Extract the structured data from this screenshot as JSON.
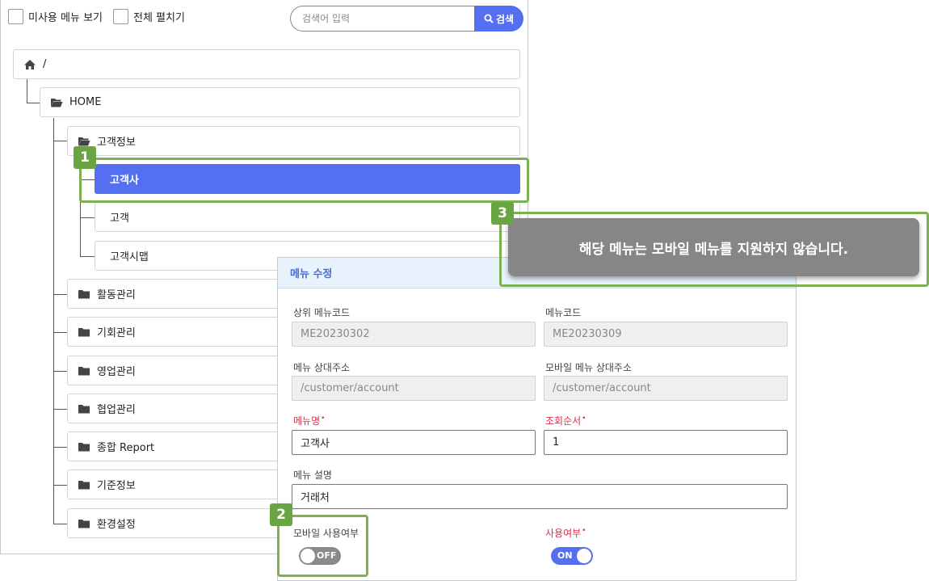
{
  "toolbar": {
    "show_unused_label": "미사용 메뉴 보기",
    "expand_all_label": "전체 펼치기",
    "search_placeholder": "검색어 입력",
    "search_button_label": "검색"
  },
  "tree": {
    "root_label": "/",
    "home_label": "HOME",
    "customer_info_label": "고객정보",
    "customer_children": [
      "고객사",
      "고객",
      "고객시맵"
    ],
    "folders": [
      "활동관리",
      "기회관리",
      "영업관리",
      "협업관리",
      "종합 Report",
      "기준정보",
      "환경설정"
    ]
  },
  "edit": {
    "title": "메뉴 수정",
    "parent_code_label": "상위 메뉴코드",
    "parent_code_value": "ME20230302",
    "menu_code_label": "메뉴코드",
    "menu_code_value": "ME20230309",
    "menu_url_label": "메뉴 상대주소",
    "menu_url_value": "/customer/account",
    "mobile_url_label": "모바일 메뉴 상대주소",
    "mobile_url_value": "/customer/account",
    "menu_name_label": "메뉴명",
    "menu_name_value": "고객사",
    "order_label": "조회순서",
    "order_value": "1",
    "desc_label": "메뉴 설명",
    "desc_value": "거래처",
    "mobile_use_label": "모바일 사용여부",
    "mobile_use_state": "OFF",
    "use_label": "사용여부",
    "use_state": "ON",
    "required_mark": "•"
  },
  "annotations": {
    "badge1": "1",
    "badge2": "2",
    "badge3": "3",
    "tooltip_text": "해당 메뉴는 모바일 메뉴를 지원하지 않습니다."
  },
  "colors": {
    "accent": "#5470f0",
    "annotation_green": "#7db053",
    "required_red": "#d9304a"
  }
}
